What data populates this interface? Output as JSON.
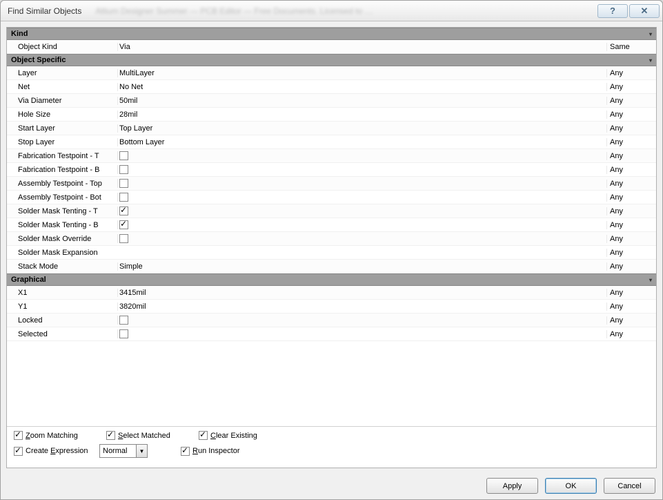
{
  "title": "Find Similar Objects",
  "groups": [
    {
      "name": "Kind",
      "rows": [
        {
          "name": "Object Kind",
          "value": "Via",
          "valueType": "text",
          "match": "Same"
        }
      ]
    },
    {
      "name": "Object Specific",
      "rows": [
        {
          "name": "Layer",
          "value": "MultiLayer",
          "valueType": "text",
          "match": "Any"
        },
        {
          "name": "Net",
          "value": "No Net",
          "valueType": "text",
          "match": "Any"
        },
        {
          "name": "Via Diameter",
          "value": "50mil",
          "valueType": "text",
          "match": "Any"
        },
        {
          "name": "Hole Size",
          "value": "28mil",
          "valueType": "text",
          "match": "Any"
        },
        {
          "name": "Start Layer",
          "value": "Top Layer",
          "valueType": "text",
          "match": "Any"
        },
        {
          "name": "Stop Layer",
          "value": "Bottom Layer",
          "valueType": "text",
          "match": "Any"
        },
        {
          "name": "Fabrication Testpoint - T",
          "value": false,
          "valueType": "check",
          "match": "Any"
        },
        {
          "name": "Fabrication Testpoint - B",
          "value": false,
          "valueType": "check",
          "match": "Any"
        },
        {
          "name": "Assembly Testpoint - Top",
          "value": false,
          "valueType": "check",
          "match": "Any"
        },
        {
          "name": "Assembly Testpoint - Bot",
          "value": false,
          "valueType": "check",
          "match": "Any"
        },
        {
          "name": "Solder Mask Tenting - T",
          "value": true,
          "valueType": "check",
          "match": "Any"
        },
        {
          "name": "Solder Mask Tenting - B",
          "value": true,
          "valueType": "check",
          "match": "Any"
        },
        {
          "name": "Solder Mask Override",
          "value": false,
          "valueType": "check",
          "match": "Any"
        },
        {
          "name": "Solder Mask Expansion",
          "value": "",
          "valueType": "text",
          "match": "Any"
        },
        {
          "name": "Stack Mode",
          "value": "Simple",
          "valueType": "text",
          "match": "Any"
        }
      ]
    },
    {
      "name": "Graphical",
      "rows": [
        {
          "name": "X1",
          "value": "3415mil",
          "valueType": "text",
          "match": "Any"
        },
        {
          "name": "Y1",
          "value": "3820mil",
          "valueType": "text",
          "match": "Any"
        },
        {
          "name": "Locked",
          "value": false,
          "valueType": "check",
          "match": "Any"
        },
        {
          "name": "Selected",
          "value": false,
          "valueType": "check",
          "match": "Any"
        }
      ]
    }
  ],
  "options": {
    "zoom_matching": {
      "label": "Zoom Matching",
      "checked": true
    },
    "select_matched": {
      "label": "Select Matched",
      "checked": true
    },
    "clear_existing": {
      "label": "Clear Existing",
      "checked": true
    },
    "create_expression": {
      "label": "Create Expression",
      "checked": true
    },
    "mask_mode": {
      "value": "Normal"
    },
    "run_inspector": {
      "label": "Run Inspector",
      "checked": true
    }
  },
  "buttons": {
    "apply": "Apply",
    "ok": "OK",
    "cancel": "Cancel"
  }
}
